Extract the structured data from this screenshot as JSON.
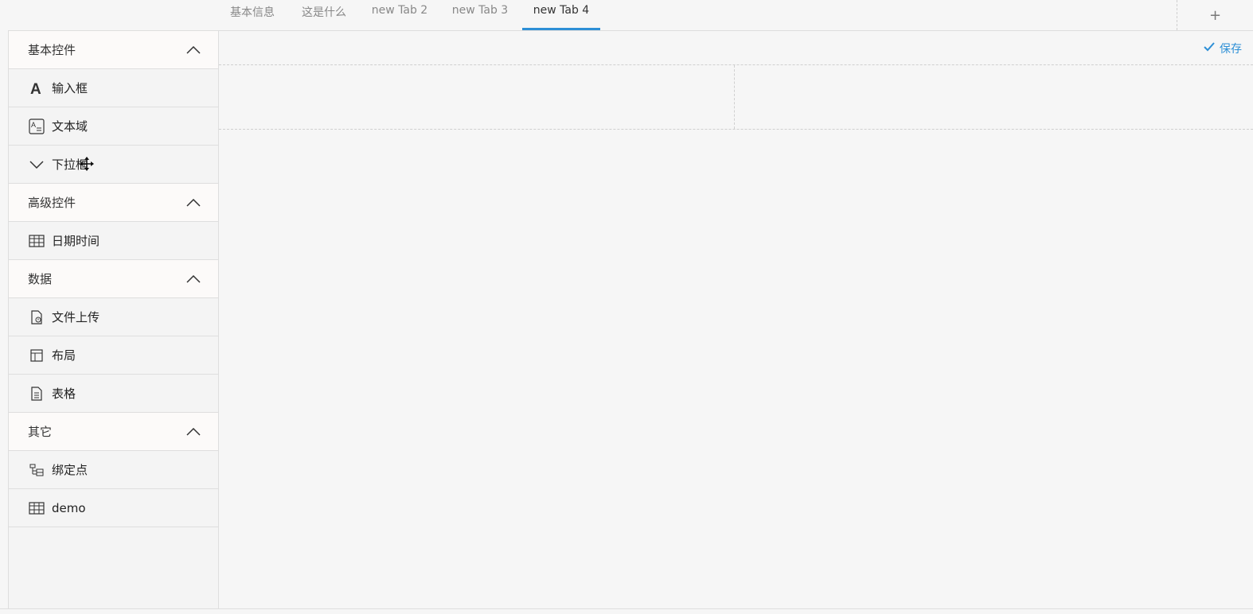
{
  "tabs": [
    {
      "label": "基本信息",
      "active": false
    },
    {
      "label": "这是什么",
      "active": false
    },
    {
      "label": "new Tab 2",
      "active": false
    },
    {
      "label": "new Tab 3",
      "active": false
    },
    {
      "label": "new Tab 4",
      "active": true
    }
  ],
  "tab_add_label": "+",
  "save_label": "保存",
  "accent_color": "#2d8fd6",
  "sidebar": {
    "groups": [
      {
        "title": "基本控件",
        "items": [
          {
            "label": "输入框",
            "icon": "letter-a-icon"
          },
          {
            "label": "文本域",
            "icon": "textarea-icon"
          },
          {
            "label": "下拉框",
            "icon": "chevron-down-icon"
          }
        ]
      },
      {
        "title": "高级控件",
        "items": [
          {
            "label": "日期时间",
            "icon": "calendar-icon"
          }
        ]
      },
      {
        "title": "数据",
        "items": [
          {
            "label": "文件上传",
            "icon": "file-upload-icon"
          },
          {
            "label": "布局",
            "icon": "layout-icon"
          },
          {
            "label": "表格",
            "icon": "document-icon"
          }
        ]
      },
      {
        "title": "其它",
        "items": [
          {
            "label": "绑定点",
            "icon": "binding-icon"
          },
          {
            "label": "demo",
            "icon": "table-icon"
          }
        ]
      }
    ]
  }
}
